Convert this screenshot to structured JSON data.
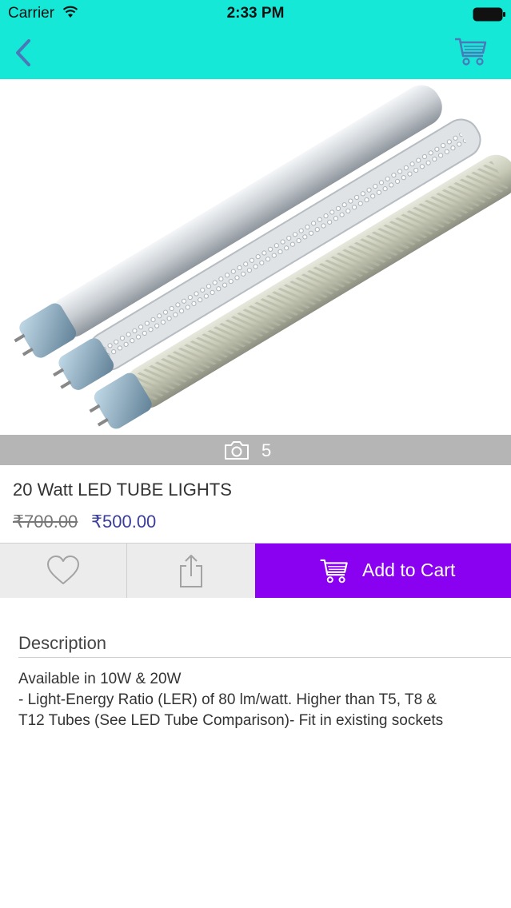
{
  "status_bar": {
    "carrier": "Carrier",
    "time": "2:33 PM"
  },
  "header": {
    "background_color": "#16e8d8",
    "icon_color": "#4a78b8",
    "back_icon": "chevron-left-icon",
    "cart_icon": "shopping-cart-icon"
  },
  "gallery": {
    "photo_count": "5",
    "camera_icon": "camera-icon"
  },
  "product": {
    "title": "20 Watt LED TUBE LIGHTS",
    "original_price": "₹700.00",
    "sale_price": "₹500.00",
    "sale_price_color": "#3a3d9a"
  },
  "actions": {
    "wishlist_icon": "heart-icon",
    "share_icon": "share-icon",
    "add_to_cart_label": "Add to Cart",
    "add_to_cart_color": "#8a00f0"
  },
  "description": {
    "heading": "Description",
    "lines": [
      "Available in 10W & 20W",
      "- Light-Energy Ratio (LER) of 80 lm/watt. Higher than T5, T8 &",
      "T12 Tubes (See LED Tube Comparison)- Fit in existing sockets"
    ]
  }
}
